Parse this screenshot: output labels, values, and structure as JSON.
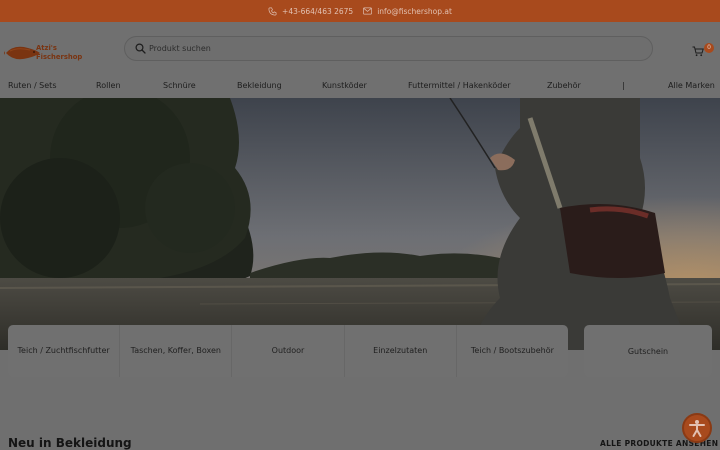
{
  "topbar": {
    "phone": "+43-664/463 2675",
    "email": "info@fischershop.at"
  },
  "header": {
    "logo_line1": "Atzi's",
    "logo_line2": "Fischershop",
    "search_placeholder": "Produkt suchen",
    "cart_count": "0"
  },
  "nav": {
    "items": [
      "Ruten / Sets",
      "Rollen",
      "Schnüre",
      "Bekleidung",
      "Kunstköder",
      "Futtermittel / Hakenköder",
      "Zubehör"
    ],
    "separator": "|",
    "all_brands": "Alle Marken"
  },
  "categories": [
    "Teich / Zuchtfischfutter",
    "Taschen, Koffer, Boxen",
    "Outdoor",
    "Einzelzutaten",
    "Teich / Bootszubehör"
  ],
  "voucher": "Gutschein",
  "section": {
    "title": "Neu in Bekleidung",
    "link": "ALLE PRODUKTE ANSEHEN"
  },
  "colors": {
    "brand": "#a84a1d",
    "overlay_bg": "#707070"
  },
  "icons": {
    "phone": "phone-icon",
    "mail": "mail-icon",
    "search": "search-icon",
    "cart": "cart-icon",
    "accessibility": "accessibility-icon"
  }
}
